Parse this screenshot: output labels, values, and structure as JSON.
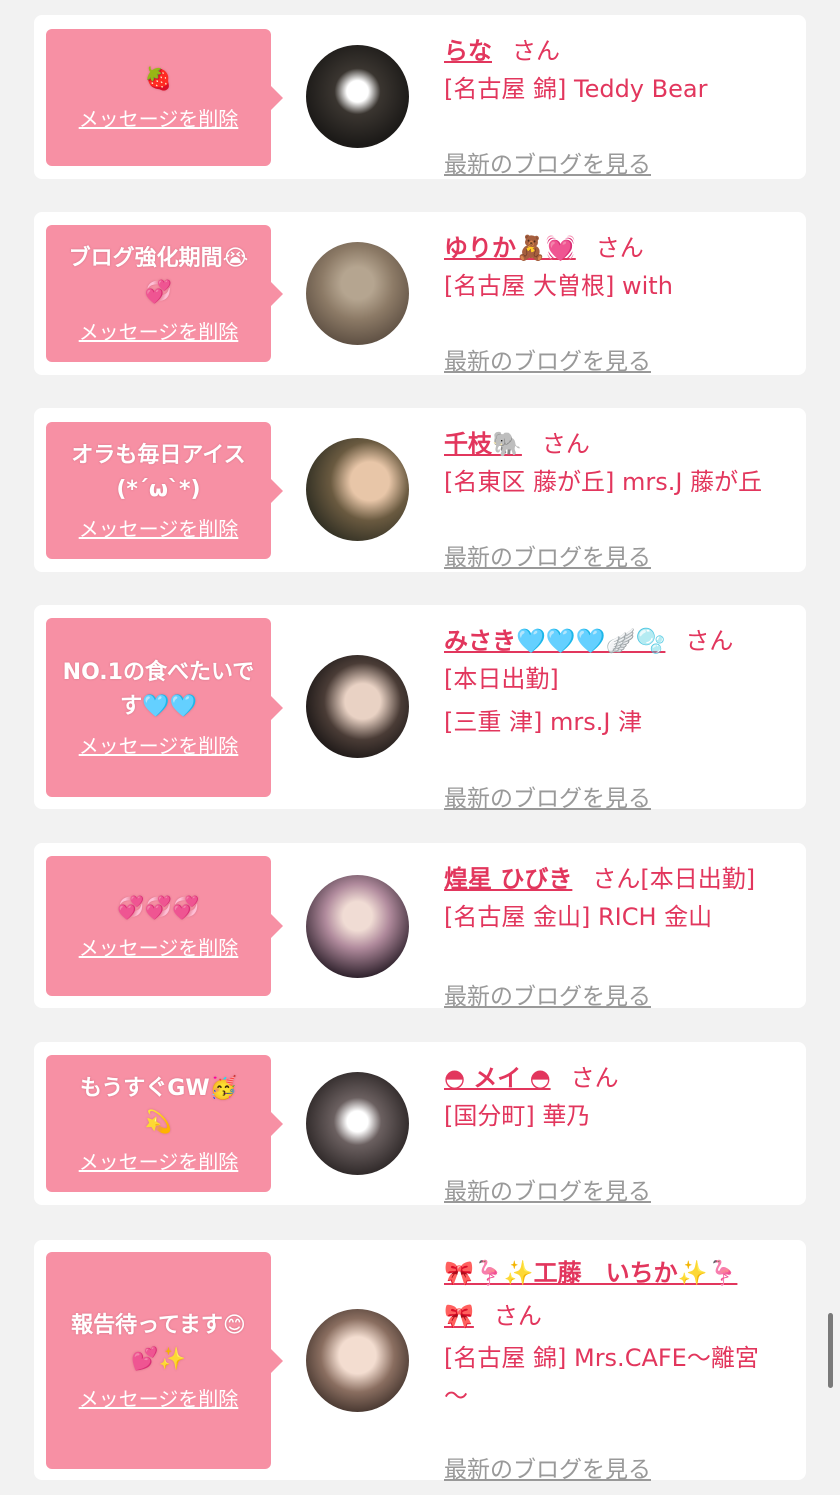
{
  "delete_label": "メッセージを削除",
  "blog_label": "最新のブログを見る",
  "san_label": "さん",
  "cards": [
    {
      "message": "🍓",
      "name": "らな",
      "lines": [
        "[名古屋 錦] Teddy Bear"
      ]
    },
    {
      "message": "ブログ強化期間😭\n💞",
      "name": "ゆりか🧸💓",
      "lines": [
        "[名古屋 大曽根] with"
      ]
    },
    {
      "message": "オラも毎日アイス\n(*´ω`*)",
      "name": "千枝🐘",
      "lines": [
        "[名東区 藤が丘] mrs.J 藤が丘"
      ]
    },
    {
      "message": "NO.1の食べたいで\nす🩵🩵",
      "name": "みさき🩵🩵🩵🪽🫧",
      "lines": [
        "[本日出勤]",
        "[三重 津] mrs.J 津"
      ]
    },
    {
      "message": "💞💞💞",
      "name": "煌星 ひびき",
      "name_suffix": "[本日出勤]",
      "lines": [
        "[名古屋 金山] RICH 金山"
      ]
    },
    {
      "message": "もうすぐGW🥳\n💫",
      "name": "◓ メイ ◓",
      "lines": [
        "[国分町] 華乃"
      ]
    },
    {
      "message": "報告待ってます😊\n💕✨",
      "name": "🎀🦩✨工藤　いちか✨🦩\n🎀",
      "lines": [
        "[名古屋 錦] Mrs.CAFE～離宮\n～"
      ]
    }
  ],
  "colors": {
    "accent": "#e2365d",
    "bubble": "#f790a4",
    "background": "#f2f2f2"
  }
}
